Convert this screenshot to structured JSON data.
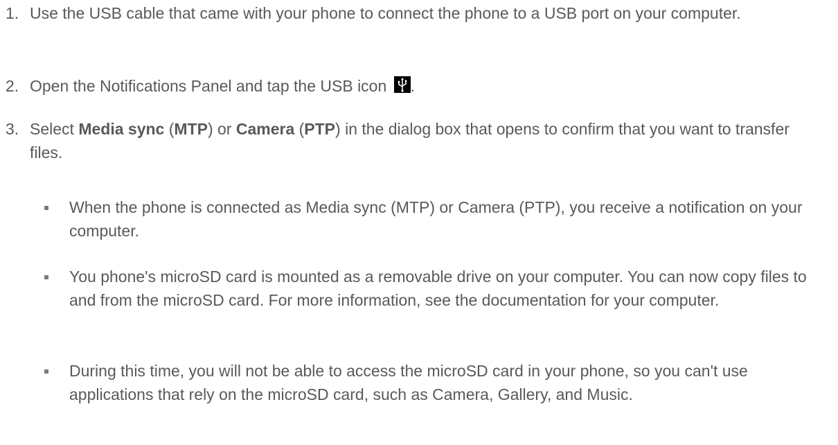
{
  "steps": [
    {
      "num": "1.",
      "text": "Use the USB cable that came with your phone to connect the phone to a USB port on your computer."
    },
    {
      "num": "2.",
      "text_before": "Open the Notifications Panel and tap the USB icon",
      "text_after": ".",
      "icon": "usb-icon"
    },
    {
      "num": "3.",
      "parts": [
        "Select ",
        "Media sync",
        " (",
        "MTP",
        ") or ",
        "Camera",
        " (",
        "PTP",
        ") in the dialog box that opens to confirm that you want to transfer files."
      ]
    }
  ],
  "bullets": [
    "When the phone is connected as Media sync (MTP) or Camera (PTP), you receive a notification on your computer.",
    "You phone's microSD card is mounted as a removable drive on your computer. You can now copy files to and from the microSD card. For more information, see the documentation for your computer.",
    "During this time, you will not be able to access the microSD card in your phone, so you can't use applications that rely on the microSD card, such as Camera, Gallery, and Music."
  ]
}
